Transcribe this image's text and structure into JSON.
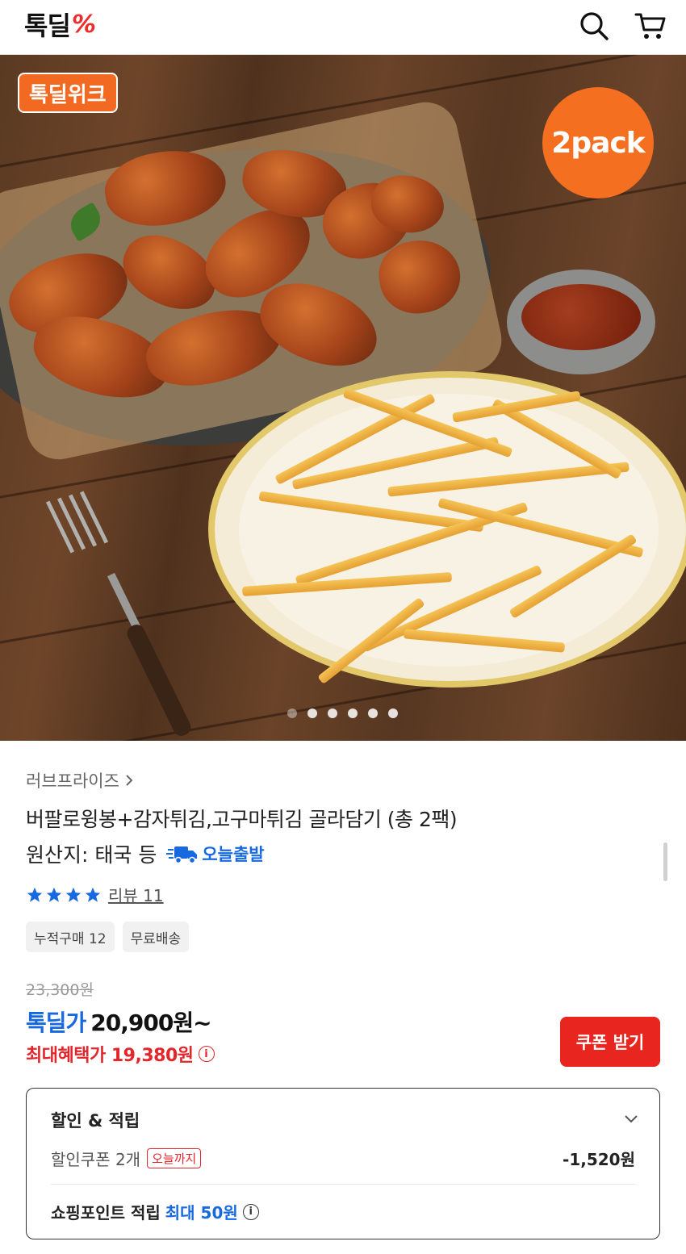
{
  "header": {
    "logo_text": "톡딜",
    "logo_mark": "%",
    "search_icon": "search-icon",
    "cart_icon": "cart-icon"
  },
  "hero": {
    "badge": "톡딜위크",
    "pack_badge": "2pack",
    "slide_count": 6,
    "active_slide": 1
  },
  "product": {
    "brand": "러브프라이즈",
    "title": "버팔로윙봉+감자튀김,고구마튀김 골라담기 (총 2팩)",
    "origin": "원산지: 태국 등",
    "shipping_badge": "오늘출발",
    "rating_stars": 4,
    "review_label": "리뷰 11",
    "tags": [
      "누적구매 12",
      "무료배송"
    ]
  },
  "price": {
    "original": "23,300원",
    "deal_label": "톡딜가",
    "deal_price": "20,900원~",
    "max_benefit": "최대혜택가 19,380원",
    "coupon_button": "쿠폰 받기"
  },
  "discount": {
    "title": "할인 & 적립",
    "coupon_text": "할인쿠폰 2개",
    "coupon_tag": "오늘까지",
    "coupon_amount": "-1,520원",
    "point_text": "쇼핑포인트 적립",
    "point_value": "최대 50원"
  },
  "colors": {
    "accent_blue": "#1769e0",
    "accent_red": "#e3262b",
    "badge_orange": "#f26a21"
  }
}
